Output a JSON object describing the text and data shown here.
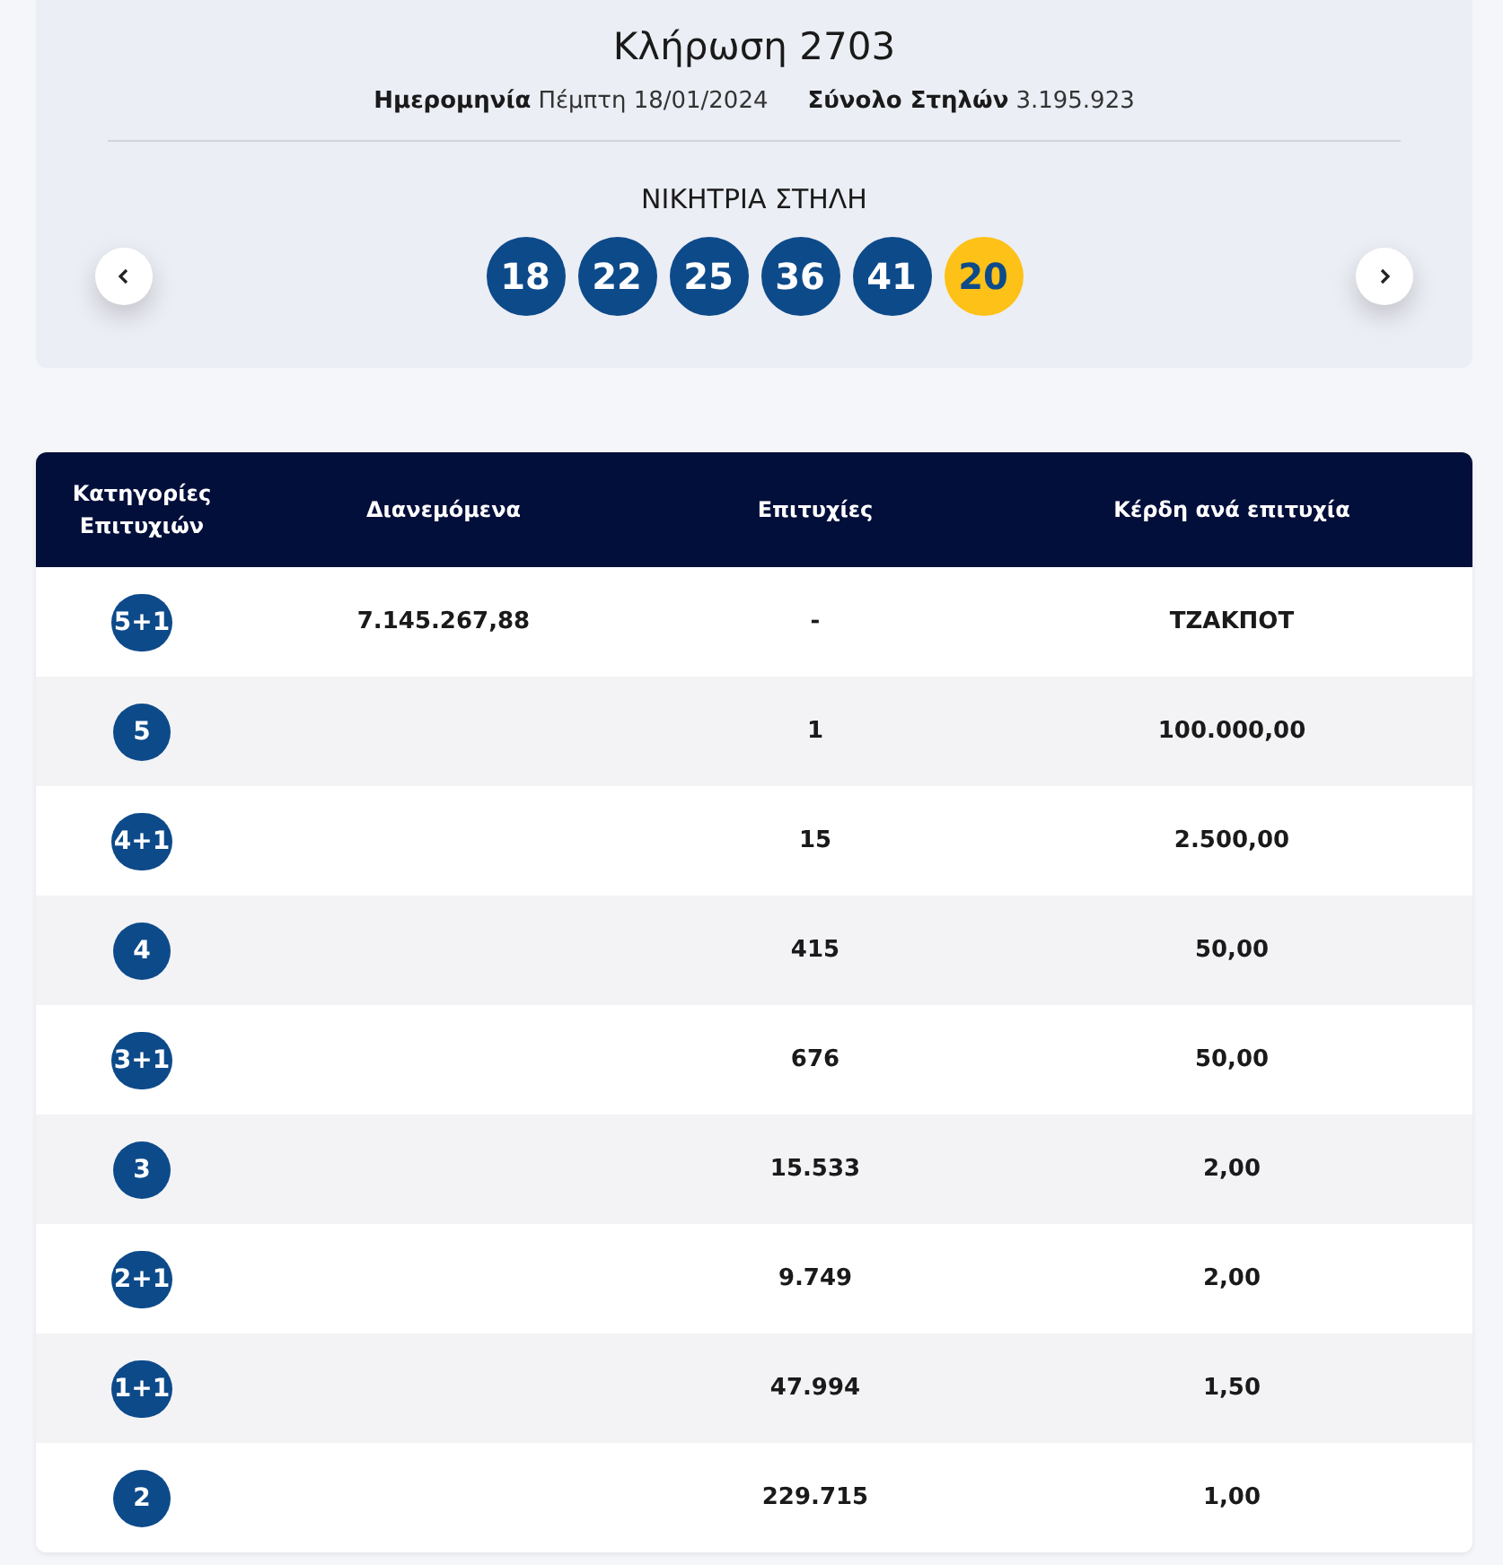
{
  "draw": {
    "title": "Κλήρωση 2703",
    "date_label": "Ημερομηνία",
    "date_value": "Πέμπτη 18/01/2024",
    "total_label": "Σύνολο Στηλών",
    "total_value": "3.195.923"
  },
  "winning": {
    "heading": "ΝΙΚΗΤΡΙΑ ΣΤΗΛΗ",
    "balls": [
      {
        "number": "18",
        "color": "#0d4a8a"
      },
      {
        "number": "22",
        "color": "#0d4a8a"
      },
      {
        "number": "25",
        "color": "#0d4a8a"
      },
      {
        "number": "36",
        "color": "#0d4a8a"
      },
      {
        "number": "41",
        "color": "#0d4a8a"
      },
      {
        "number": "20",
        "color": "#fdc117"
      }
    ]
  },
  "table": {
    "columns": [
      "Κατηγορίες Επιτυχιών",
      "Διανεμόμενα",
      "Επιτυχίες",
      "Κέρδη ανά επιτυχία"
    ],
    "rows": [
      {
        "category": "5+1",
        "distributed": "7.145.267,88",
        "winners": "-",
        "prize": "ΤΖΑΚΠΟΤ"
      },
      {
        "category": "5",
        "winners": "1",
        "prize": "100.000,00"
      },
      {
        "category": "4+1",
        "winners": "15",
        "prize": "2.500,00"
      },
      {
        "category": "4",
        "winners": "415",
        "prize": "50,00"
      },
      {
        "category": "3+1",
        "winners": "676",
        "prize": "50,00"
      },
      {
        "category": "3",
        "winners": "15.533",
        "prize": "2,00"
      },
      {
        "category": "2+1",
        "winners": "9.749",
        "prize": "2,00"
      },
      {
        "category": "1+1",
        "winners": "47.994",
        "prize": "1,50"
      },
      {
        "category": "2",
        "winners": "229.715",
        "prize": "1,00"
      }
    ]
  }
}
